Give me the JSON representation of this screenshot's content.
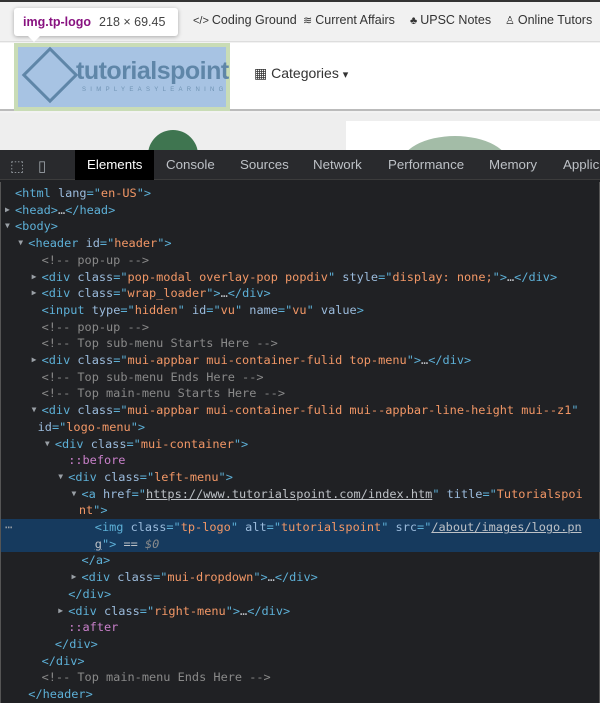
{
  "page": {
    "tooltip": {
      "selector": "img.tp-logo",
      "size": "218 × 69.45"
    },
    "topnav": [
      {
        "icon": "code-icon",
        "glyph": "</>",
        "label": "Coding Ground"
      },
      {
        "icon": "current-affairs-icon",
        "glyph": "≋",
        "label": "Current Affairs"
      },
      {
        "icon": "upsc-icon",
        "glyph": "♣",
        "label": "UPSC Notes"
      },
      {
        "icon": "user-icon",
        "glyph": "♙",
        "label": "Online Tutors"
      }
    ],
    "logo": {
      "text": "tutorialspoint",
      "tagline": "SIMPLYEASYLEARNING"
    },
    "categories": {
      "glyph": "▦",
      "label": "Categories",
      "caret": "▾"
    }
  },
  "devtools": {
    "tabs": [
      "Elements",
      "Console",
      "Sources",
      "Network",
      "Performance",
      "Memory",
      "Applic"
    ],
    "active_tab": "Elements",
    "lines": [
      {
        "depth": 0,
        "arrow": "",
        "tokens": [
          [
            "t",
            "<html "
          ],
          [
            "a",
            "lang"
          ],
          [
            "t",
            "=\""
          ],
          [
            "v",
            "en-US"
          ],
          [
            "t",
            "\">"
          ]
        ]
      },
      {
        "depth": 0,
        "arrow": "▶",
        "tokens": [
          [
            "t",
            "<head>"
          ],
          [
            "x",
            "…"
          ],
          [
            "t",
            "</head>"
          ]
        ]
      },
      {
        "depth": 0,
        "arrow": "▼",
        "tokens": [
          [
            "t",
            "<body>"
          ]
        ]
      },
      {
        "depth": 1,
        "arrow": "▼",
        "tokens": [
          [
            "t",
            "<header "
          ],
          [
            "a",
            "id"
          ],
          [
            "t",
            "=\""
          ],
          [
            "v",
            "header"
          ],
          [
            "t",
            "\">"
          ]
        ]
      },
      {
        "depth": 2,
        "arrow": "",
        "tokens": [
          [
            "c",
            "<!-- pop-up -->"
          ]
        ]
      },
      {
        "depth": 2,
        "arrow": "▶",
        "tokens": [
          [
            "t",
            "<div "
          ],
          [
            "a",
            "class"
          ],
          [
            "t",
            "=\""
          ],
          [
            "v",
            "pop-modal overlay-pop popdiv"
          ],
          [
            "t",
            "\" "
          ],
          [
            "a",
            "style"
          ],
          [
            "t",
            "=\""
          ],
          [
            "v",
            "display: none;"
          ],
          [
            "t",
            "\">"
          ],
          [
            "x",
            "…"
          ],
          [
            "t",
            "</div>"
          ]
        ]
      },
      {
        "depth": 2,
        "arrow": "▶",
        "tokens": [
          [
            "t",
            "<div "
          ],
          [
            "a",
            "class"
          ],
          [
            "t",
            "=\""
          ],
          [
            "v",
            "wrap_loader"
          ],
          [
            "t",
            "\">"
          ],
          [
            "x",
            "…"
          ],
          [
            "t",
            "</div>"
          ]
        ]
      },
      {
        "depth": 2,
        "arrow": "",
        "tokens": [
          [
            "t",
            "<input "
          ],
          [
            "a",
            "type"
          ],
          [
            "t",
            "=\""
          ],
          [
            "v",
            "hidden"
          ],
          [
            "t",
            "\" "
          ],
          [
            "a",
            "id"
          ],
          [
            "t",
            "=\""
          ],
          [
            "v",
            "vu"
          ],
          [
            "t",
            "\" "
          ],
          [
            "a",
            "name"
          ],
          [
            "t",
            "=\""
          ],
          [
            "v",
            "vu"
          ],
          [
            "t",
            "\" "
          ],
          [
            "a",
            "value"
          ],
          [
            "t",
            ">"
          ]
        ]
      },
      {
        "depth": 2,
        "arrow": "",
        "tokens": [
          [
            "c",
            "<!-- pop-up -->"
          ]
        ]
      },
      {
        "depth": 2,
        "arrow": "",
        "tokens": [
          [
            "c",
            "<!-- Top sub-menu Starts Here -->"
          ]
        ]
      },
      {
        "depth": 2,
        "arrow": "▶",
        "tokens": [
          [
            "t",
            "<div "
          ],
          [
            "a",
            "class"
          ],
          [
            "t",
            "=\""
          ],
          [
            "v",
            "mui-appbar mui-container-fulid top-menu"
          ],
          [
            "t",
            "\">"
          ],
          [
            "x",
            "…"
          ],
          [
            "t",
            "</div>"
          ]
        ]
      },
      {
        "depth": 2,
        "arrow": "",
        "tokens": [
          [
            "c",
            "<!-- Top sub-menu Ends Here -->"
          ]
        ]
      },
      {
        "depth": 2,
        "arrow": "",
        "tokens": [
          [
            "c",
            "<!-- Top main-menu Starts Here -->"
          ]
        ]
      },
      {
        "depth": 2,
        "arrow": "▼",
        "tokens": [
          [
            "t",
            "<div "
          ],
          [
            "a",
            "class"
          ],
          [
            "t",
            "=\""
          ],
          [
            "v",
            "mui-appbar mui-container-fulid mui--appbar-line-height mui--z1"
          ],
          [
            "t",
            "\""
          ]
        ]
      },
      {
        "depth": 1.7,
        "arrow": "",
        "tokens": [
          [
            "a",
            "id"
          ],
          [
            "t",
            "=\""
          ],
          [
            "v",
            "logo-menu"
          ],
          [
            "t",
            "\">"
          ]
        ]
      },
      {
        "depth": 3,
        "arrow": "▼",
        "tokens": [
          [
            "t",
            "<div "
          ],
          [
            "a",
            "class"
          ],
          [
            "t",
            "=\""
          ],
          [
            "v",
            "mui-container"
          ],
          [
            "t",
            "\">"
          ]
        ]
      },
      {
        "depth": 4,
        "arrow": "",
        "tokens": [
          [
            "p",
            "::before"
          ]
        ]
      },
      {
        "depth": 4,
        "arrow": "▼",
        "tokens": [
          [
            "t",
            "<div "
          ],
          [
            "a",
            "class"
          ],
          [
            "t",
            "=\""
          ],
          [
            "v",
            "left-menu"
          ],
          [
            "t",
            "\">"
          ]
        ]
      },
      {
        "depth": 5,
        "arrow": "▼",
        "tokens": [
          [
            "t",
            "<a "
          ],
          [
            "a",
            "href"
          ],
          [
            "t",
            "=\""
          ],
          [
            "l",
            "https://www.tutorialspoint.com/index.htm"
          ],
          [
            "t",
            "\" "
          ],
          [
            "a",
            "title"
          ],
          [
            "t",
            "=\""
          ],
          [
            "v",
            "Tutorialspoi"
          ]
        ]
      },
      {
        "depth": 4.8,
        "arrow": "",
        "tokens": [
          [
            "v",
            "nt"
          ],
          [
            "t",
            "\">"
          ]
        ]
      },
      {
        "depth": 6,
        "arrow": "",
        "selected": true,
        "tokens": [
          [
            "t",
            "<img "
          ],
          [
            "a",
            "class"
          ],
          [
            "t",
            "=\""
          ],
          [
            "v",
            "tp-logo"
          ],
          [
            "t",
            "\" "
          ],
          [
            "a",
            "alt"
          ],
          [
            "t",
            "=\""
          ],
          [
            "v",
            "tutorialspoint"
          ],
          [
            "t",
            "\" "
          ],
          [
            "a",
            "src"
          ],
          [
            "t",
            "=\""
          ],
          [
            "l",
            "/about/images/logo.pn"
          ]
        ]
      },
      {
        "depth": 6,
        "arrow": "",
        "selected": true,
        "tokens": [
          [
            "l",
            "g"
          ],
          [
            "t",
            "\">"
          ],
          [
            "x",
            " == "
          ],
          [
            "d",
            "$0"
          ]
        ]
      },
      {
        "depth": 5,
        "arrow": "",
        "tokens": [
          [
            "t",
            "</a>"
          ]
        ]
      },
      {
        "depth": 5,
        "arrow": "▶",
        "tokens": [
          [
            "t",
            "<div "
          ],
          [
            "a",
            "class"
          ],
          [
            "t",
            "=\""
          ],
          [
            "v",
            "mui-dropdown"
          ],
          [
            "t",
            "\">"
          ],
          [
            "x",
            "…"
          ],
          [
            "t",
            "</div>"
          ]
        ]
      },
      {
        "depth": 4,
        "arrow": "",
        "tokens": [
          [
            "t",
            "</div>"
          ]
        ]
      },
      {
        "depth": 4,
        "arrow": "▶",
        "tokens": [
          [
            "t",
            "<div "
          ],
          [
            "a",
            "class"
          ],
          [
            "t",
            "=\""
          ],
          [
            "v",
            "right-menu"
          ],
          [
            "t",
            "\">"
          ],
          [
            "x",
            "…"
          ],
          [
            "t",
            "</div>"
          ]
        ]
      },
      {
        "depth": 4,
        "arrow": "",
        "tokens": [
          [
            "p",
            "::after"
          ]
        ]
      },
      {
        "depth": 3,
        "arrow": "",
        "tokens": [
          [
            "t",
            "</div>"
          ]
        ]
      },
      {
        "depth": 2,
        "arrow": "",
        "tokens": [
          [
            "t",
            "</div>"
          ]
        ]
      },
      {
        "depth": 2,
        "arrow": "",
        "tokens": [
          [
            "c",
            "<!-- Top main-menu Ends Here -->"
          ]
        ]
      },
      {
        "depth": 1,
        "arrow": "",
        "tokens": [
          [
            "t",
            "</header>"
          ]
        ]
      }
    ]
  }
}
